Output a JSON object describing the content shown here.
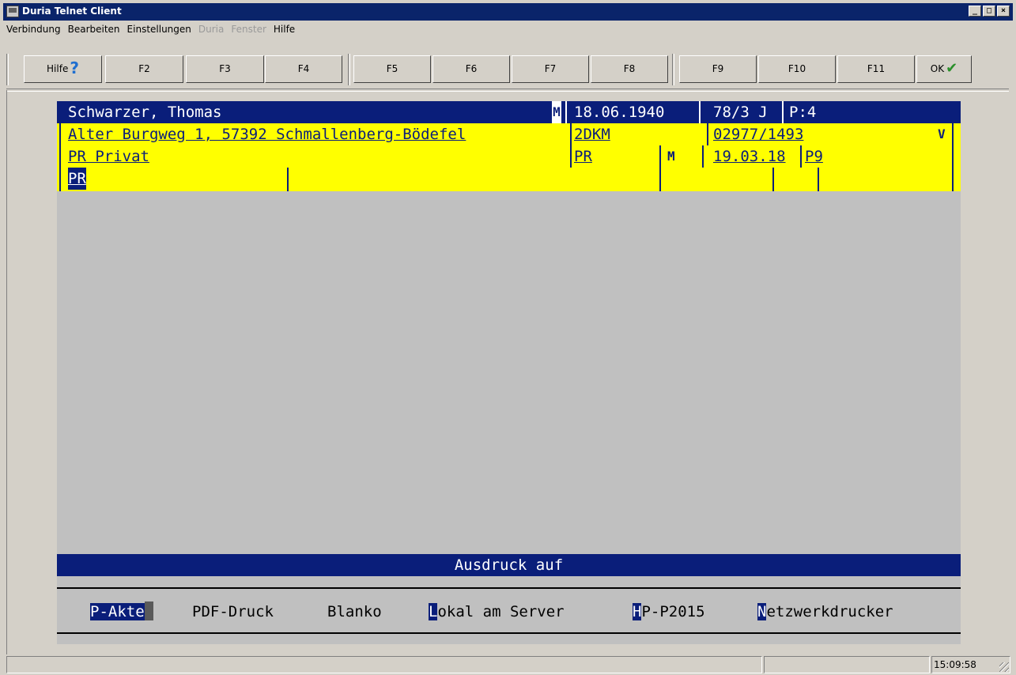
{
  "window": {
    "title": "Duria Telnet Client"
  },
  "menu": [
    "Verbindung",
    "Bearbeiten",
    "Einstellungen",
    "Duria",
    "Fenster",
    "Hilfe"
  ],
  "menu_disabled": [
    "Duria",
    "Fenster"
  ],
  "toolbar": {
    "help": "Hilfe",
    "keys": [
      "F2",
      "F3",
      "F4",
      "F5",
      "F6",
      "F7",
      "F8",
      "F9",
      "F10",
      "F11"
    ],
    "ok": "OK"
  },
  "patient": {
    "name": "Schwarzer, Thomas",
    "sex": "M",
    "dob": "18.06.1940",
    "age": "78/3 J",
    "p": "P:4",
    "address": "Alter Burgweg 1, 57392 Schmallenberg-Bödefel",
    "code": "2DKM",
    "phone": "02977/1493",
    "flag": "V",
    "insurance": "PR Privat",
    "ins_code": "PR",
    "ins_m": "M",
    "date": "19.03.18",
    "p9": "P9",
    "input": "PR"
  },
  "print_dialog": {
    "title": "Ausdruck auf",
    "options": [
      {
        "key": "P-Akte",
        "rest": ""
      },
      {
        "key": "",
        "rest": "PDF-Druck"
      },
      {
        "key": "",
        "rest": "Blanko"
      },
      {
        "key": "L",
        "rest": "okal am Server"
      },
      {
        "key": "H",
        "rest": "P-P2015"
      },
      {
        "key": "N",
        "rest": "etzwerkdrucker"
      }
    ]
  },
  "status": {
    "time": "15:09:58"
  },
  "colors": {
    "navy": "#0a1e7a",
    "yellow": "#ffff00",
    "screen": "#c0c0c0",
    "titlebar": "#0a246a"
  }
}
